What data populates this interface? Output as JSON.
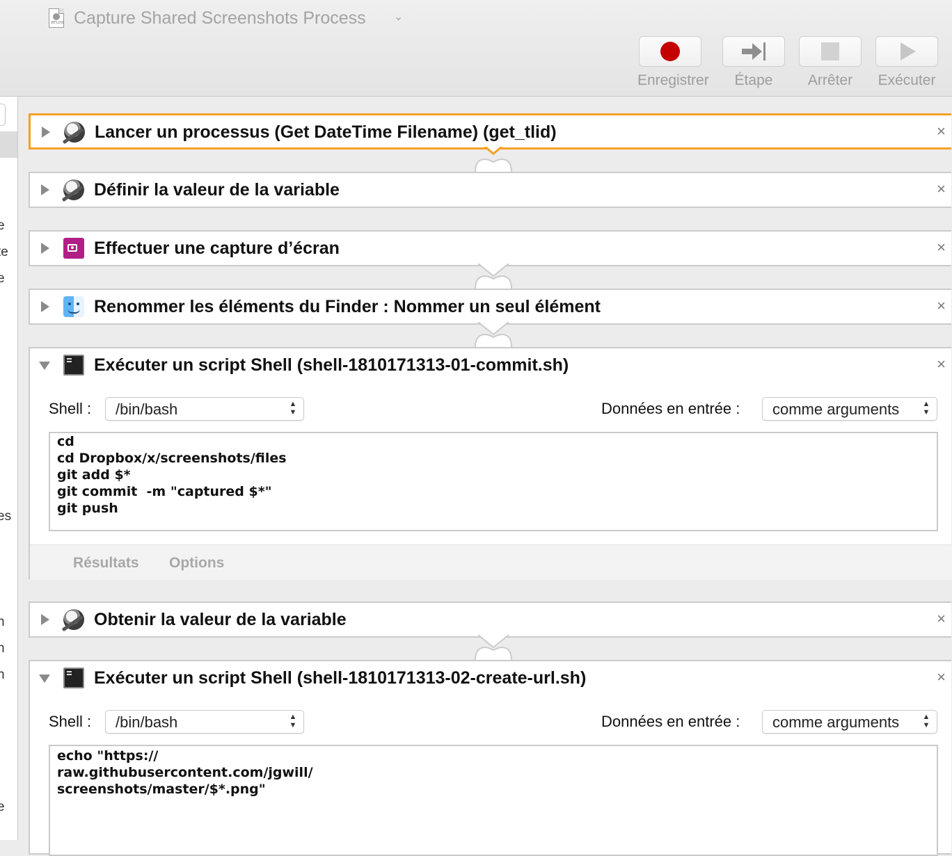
{
  "window": {
    "title": "Capture Shared Screenshots Process",
    "title_chevron": "⌄"
  },
  "toolbar": {
    "record_label": "Enregistrer",
    "step_label": "Étape",
    "stop_label": "Arrêter",
    "run_label": "Exécuter"
  },
  "left_panel": {
    "fragments": [
      "e",
      "te",
      "e",
      "es",
      "n",
      "n",
      "n",
      "e"
    ]
  },
  "actions": [
    {
      "title": "Lancer un processus (Get DateTime Filename) (get_tlid)",
      "icon": "automator-robot-icon",
      "expanded": false,
      "selected": true
    },
    {
      "title": "Définir la valeur de la variable",
      "icon": "automator-robot-icon",
      "expanded": false
    },
    {
      "title": "Effectuer une capture d’écran",
      "icon": "screenshot-icon",
      "expanded": false
    },
    {
      "title": "Renommer les éléments du Finder : Nommer un seul élément",
      "icon": "finder-icon",
      "expanded": false
    },
    {
      "title": "Exécuter un script Shell (shell-1810171313-01-commit.sh)",
      "icon": "terminal-icon",
      "expanded": true,
      "shell_label": "Shell :",
      "shell_value": "/bin/bash",
      "input_label": "Données en entrée :",
      "input_value": "comme arguments",
      "script": [
        "cd",
        "cd Dropbox/x/screenshots/files",
        "git add $*",
        "git commit  -m \"captured $*\"",
        "git push"
      ],
      "tabs": [
        "Résultats",
        "Options"
      ]
    },
    {
      "title": "Obtenir la valeur de la variable",
      "icon": "automator-robot-icon",
      "expanded": false
    },
    {
      "title": "Exécuter un script Shell (shell-1810171313-02-create-url.sh)",
      "icon": "terminal-icon",
      "expanded": true,
      "shell_label": "Shell :",
      "shell_value": "/bin/bash",
      "input_label": "Données en entrée :",
      "input_value": "comme arguments",
      "script": [
        "echo \"https://",
        "raw.githubusercontent.com/jgwill/",
        "screenshots/master/$*.png\""
      ]
    }
  ],
  "common": {
    "close_glyph": "×",
    "popup_arrows": "⌃⌄",
    "doc_icon_caption": "WFLOW"
  },
  "colors": {
    "selection_accent": "#f5a023",
    "record_red": "#c40000",
    "screenshot_magenta": "#b11f86"
  }
}
